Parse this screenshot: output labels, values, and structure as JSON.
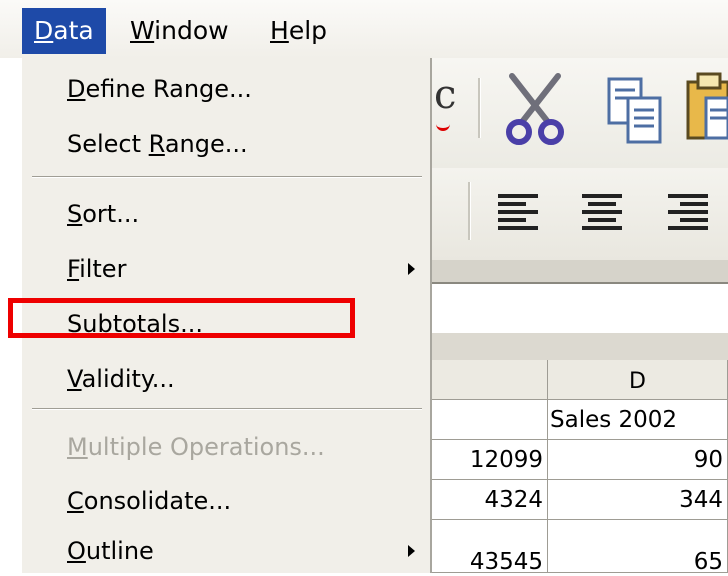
{
  "menubar": {
    "items": [
      {
        "pre": "",
        "u": "D",
        "post": "ata",
        "active": true
      },
      {
        "pre": "",
        "u": "W",
        "post": "indow",
        "active": false
      },
      {
        "pre": "",
        "u": "H",
        "post": "elp",
        "active": false
      }
    ]
  },
  "data_menu": {
    "items": [
      {
        "pre": "",
        "u": "D",
        "post": "efine Range...",
        "disabled": false,
        "submenu": false
      },
      {
        "pre": "Select ",
        "u": "R",
        "post": "ange...",
        "disabled": false,
        "submenu": false
      },
      {
        "pre": "",
        "u": "S",
        "post": "ort...",
        "disabled": false,
        "submenu": false
      },
      {
        "pre": "",
        "u": "F",
        "post": "ilter",
        "disabled": false,
        "submenu": true
      },
      {
        "pre": "Su",
        "u": "b",
        "post": "totals...",
        "disabled": false,
        "submenu": false
      },
      {
        "pre": "",
        "u": "V",
        "post": "alidity...",
        "disabled": false,
        "submenu": false
      },
      {
        "pre": "",
        "u": "M",
        "post": "ultiple Operations...",
        "disabled": true,
        "submenu": false
      },
      {
        "pre": "",
        "u": "C",
        "post": "onsolidate...",
        "disabled": false,
        "submenu": false
      },
      {
        "pre": "",
        "u": "O",
        "post": "utline",
        "disabled": false,
        "submenu": true
      }
    ]
  },
  "toolbar": {
    "partial_label": "c",
    "icons": [
      "cut-icon",
      "copy-icon",
      "paste-icon",
      "align-left-icon",
      "align-center-icon",
      "align-right-icon"
    ]
  },
  "sheet": {
    "column_d_header": "D",
    "header_cell": "Sales 2002",
    "rows": [
      {
        "c": "12099",
        "d": "90"
      },
      {
        "c": "4324",
        "d": "344"
      },
      {
        "c": "43545",
        "d": "65"
      }
    ]
  },
  "colors": {
    "active_menu": "#1e4aa8",
    "highlight": "#ee0000",
    "menu_bg": "#f1efe9"
  }
}
